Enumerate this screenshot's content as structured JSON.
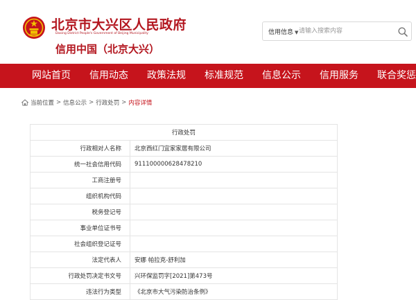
{
  "header": {
    "site_title": "北京市大兴区人民政府",
    "site_subtitle": "Daxing District People's Government of Beijing Municipality",
    "credit_title": "信用中国（北京大兴）"
  },
  "search": {
    "select_label": "信用信息",
    "placeholder": "请输入搜索内容"
  },
  "nav": {
    "items": [
      "网站首页",
      "信用动态",
      "政策法规",
      "标准规范",
      "信息公示",
      "信用服务",
      "联合奖惩"
    ]
  },
  "breadcrumb": {
    "items": [
      "当前位置",
      "信息公示",
      "行政处罚"
    ],
    "current": "内容详情"
  },
  "detail": {
    "caption": "行政处罚",
    "rows": [
      {
        "label": "行政相对人名称",
        "value": "北京西红门宜家家居有限公司"
      },
      {
        "label": "统一社会信用代码",
        "value": "911100000628478210"
      },
      {
        "label": "工商注册号",
        "value": ""
      },
      {
        "label": "组织机构代码",
        "value": ""
      },
      {
        "label": "税务登记号",
        "value": ""
      },
      {
        "label": "事业单位证书号",
        "value": ""
      },
      {
        "label": "社会组织登记证号",
        "value": ""
      },
      {
        "label": "法定代表人",
        "value": "安娜 帕拉克-舒利加"
      },
      {
        "label": "行政处罚决定书文号",
        "value": "兴环保监罚字[2021]第473号"
      },
      {
        "label": "违法行为类型",
        "value": "《北京市大气污染防治条例》"
      }
    ]
  },
  "colors": {
    "brand_red": "#c6141c",
    "title_red": "#b3161f"
  },
  "icons": [
    "national-emblem-icon",
    "search-icon",
    "home-icon",
    "chevron-down-icon"
  ]
}
